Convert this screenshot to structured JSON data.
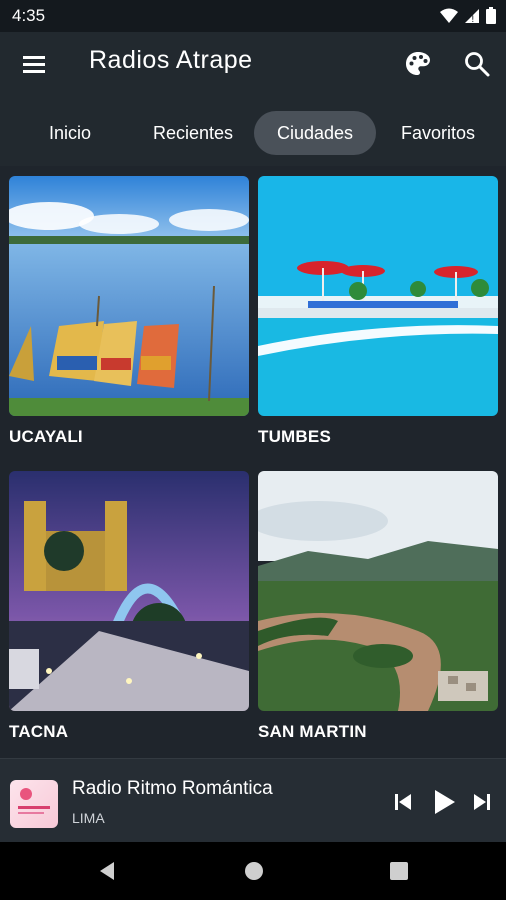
{
  "status_bar": {
    "time": "4:35"
  },
  "app_bar": {
    "title": "Radios Atrape"
  },
  "tabs": [
    {
      "label": "Inicio"
    },
    {
      "label": "Recientes"
    },
    {
      "label": "Ciudades",
      "active": true
    },
    {
      "label": "Favoritos"
    }
  ],
  "cities": [
    {
      "name": "UCAYALI"
    },
    {
      "name": "TUMBES"
    },
    {
      "name": "TACNA"
    },
    {
      "name": "SAN MARTIN"
    }
  ],
  "player": {
    "station": "Radio Ritmo Romántica",
    "city": "LIMA"
  },
  "colors": {
    "background": "#1f252c",
    "appbar": "#22292f",
    "active_tab": "#4a5159"
  }
}
